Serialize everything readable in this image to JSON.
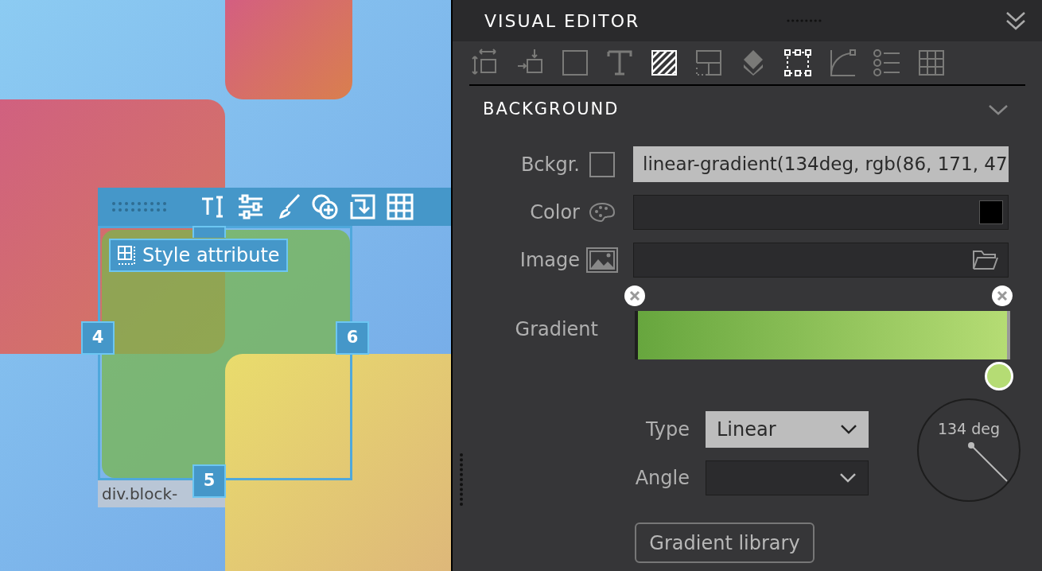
{
  "canvas": {
    "style_label": "Style attribute",
    "handles": [
      {
        "label": "4"
      },
      {
        "label": "6"
      },
      {
        "label": "5"
      }
    ],
    "element_label": "div.block-"
  },
  "panel": {
    "title": "VISUAL EDITOR",
    "tools": [
      {
        "kind": "size",
        "selected": false
      },
      {
        "kind": "position",
        "selected": false
      },
      {
        "kind": "border",
        "selected": false
      },
      {
        "kind": "text",
        "selected": false
      },
      {
        "kind": "background",
        "selected": true
      },
      {
        "kind": "layout",
        "selected": false
      },
      {
        "kind": "effects",
        "selected": false
      },
      {
        "kind": "box",
        "selected": true
      },
      {
        "kind": "radius",
        "selected": false
      },
      {
        "kind": "list",
        "selected": false
      },
      {
        "kind": "table",
        "selected": false
      }
    ],
    "section": {
      "title": "BACKGROUND",
      "expanded": true
    },
    "background": {
      "label": "Bckgr.",
      "value": "linear-gradient(134deg, rgb(86, 171, 47"
    },
    "color": {
      "label": "Color",
      "color": "#000000"
    },
    "image": {
      "label": "Image"
    },
    "gradient": {
      "label": "Gradient",
      "stops": [
        {
          "color": "#67a63e",
          "selected": false
        },
        {
          "color": "#b5dc74",
          "selected": true
        }
      ]
    },
    "type": {
      "label": "Type",
      "value": "Linear"
    },
    "angle": {
      "label": "Angle"
    },
    "dial": {
      "reading": "134 deg"
    },
    "library_button": "Gradient library"
  }
}
